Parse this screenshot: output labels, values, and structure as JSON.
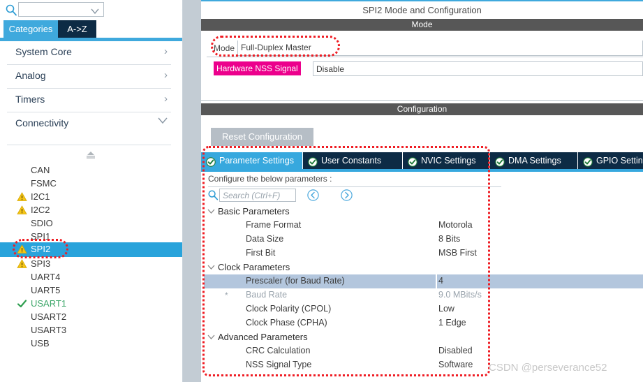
{
  "sidebar": {
    "search": {
      "icon": "search-icon",
      "value": "",
      "placeholder": ""
    },
    "gear_icon": "gear-icon",
    "tabs": [
      {
        "label": "Categories",
        "active": true
      },
      {
        "label": "A->Z",
        "active": false
      }
    ],
    "categories": [
      {
        "label": "System Core",
        "expanded": false,
        "chevron": "chevron-right-icon"
      },
      {
        "label": "Analog",
        "expanded": false,
        "chevron": "chevron-right-icon"
      },
      {
        "label": "Timers",
        "expanded": false,
        "chevron": "chevron-right-icon"
      },
      {
        "label": "Connectivity",
        "expanded": true,
        "chevron": "chevron-down-icon"
      }
    ],
    "peripherals": [
      {
        "label": "CAN",
        "status": "none",
        "selected": false
      },
      {
        "label": "FSMC",
        "status": "none",
        "selected": false
      },
      {
        "label": "I2C1",
        "status": "warning",
        "selected": false
      },
      {
        "label": "I2C2",
        "status": "warning",
        "selected": false
      },
      {
        "label": "SDIO",
        "status": "none",
        "selected": false
      },
      {
        "label": "SPI1",
        "status": "none",
        "selected": false
      },
      {
        "label": "SPI2",
        "status": "warning",
        "selected": true
      },
      {
        "label": "SPI3",
        "status": "warning",
        "selected": false
      },
      {
        "label": "UART4",
        "status": "none",
        "selected": false
      },
      {
        "label": "UART5",
        "status": "none",
        "selected": false
      },
      {
        "label": "USART1",
        "status": "ok",
        "selected": false
      },
      {
        "label": "USART2",
        "status": "none",
        "selected": false
      },
      {
        "label": "USART3",
        "status": "none",
        "selected": false
      },
      {
        "label": "USB",
        "status": "none",
        "selected": false
      }
    ]
  },
  "right": {
    "title": "SPI2 Mode and Configuration",
    "mode_section": {
      "header": "Mode",
      "mode_label": "Mode",
      "mode_value": "Full-Duplex Master",
      "nss_label": "Hardware NSS Signal",
      "nss_value": "Disable"
    },
    "config_section": {
      "header": "Configuration",
      "reset_button": "Reset Configuration",
      "tabs": [
        {
          "label": "Parameter Settings",
          "active": true
        },
        {
          "label": "User Constants",
          "active": false
        },
        {
          "label": "NVIC Settings",
          "active": false
        },
        {
          "label": "DMA Settings",
          "active": false
        },
        {
          "label": "GPIO Settin",
          "active": false
        }
      ],
      "hint": "Configure the below parameters :",
      "search_placeholder": "Search (Ctrl+F)",
      "search_value": "",
      "nav_prev_icon": "chevron-left-circle-icon",
      "nav_next_icon": "chevron-right-circle-icon",
      "parameters": [
        {
          "kind": "group",
          "name": "Basic Parameters",
          "value": "",
          "expanded": true,
          "selected": false,
          "dim": false,
          "star": false
        },
        {
          "kind": "item",
          "name": "Frame Format",
          "value": "Motorola",
          "selected": false,
          "dim": false,
          "star": false
        },
        {
          "kind": "item",
          "name": "Data Size",
          "value": "8 Bits",
          "selected": false,
          "dim": false,
          "star": false
        },
        {
          "kind": "item",
          "name": "First Bit",
          "value": "MSB First",
          "selected": false,
          "dim": false,
          "star": false
        },
        {
          "kind": "group",
          "name": "Clock Parameters",
          "value": "",
          "expanded": true,
          "selected": false,
          "dim": false,
          "star": false
        },
        {
          "kind": "item",
          "name": "Prescaler (for Baud Rate)",
          "value": "4",
          "selected": true,
          "dim": false,
          "star": false
        },
        {
          "kind": "item",
          "name": "Baud Rate",
          "value": "9.0 MBits/s",
          "selected": false,
          "dim": true,
          "star": true
        },
        {
          "kind": "item",
          "name": "Clock Polarity (CPOL)",
          "value": "Low",
          "selected": false,
          "dim": false,
          "star": false
        },
        {
          "kind": "item",
          "name": "Clock Phase (CPHA)",
          "value": "1 Edge",
          "selected": false,
          "dim": false,
          "star": false
        },
        {
          "kind": "group",
          "name": "Advanced Parameters",
          "value": "",
          "expanded": true,
          "selected": false,
          "dim": false,
          "star": false
        },
        {
          "kind": "item",
          "name": "CRC Calculation",
          "value": "Disabled",
          "selected": false,
          "dim": false,
          "star": false
        },
        {
          "kind": "item",
          "name": "NSS Signal Type",
          "value": "Software",
          "selected": false,
          "dim": false,
          "star": false
        }
      ]
    }
  },
  "watermark": "CSDN @perseverance52",
  "colors": {
    "accent_blue": "#37a8de",
    "dark_navy": "#0d2b45",
    "section_gray": "#575757",
    "magenta": "#ec008c",
    "highlight_row": "#b3c6dd",
    "annotation_red": "#ef1c23",
    "warning_yellow": "#f5c518",
    "ok_green": "#2e9e4f"
  }
}
